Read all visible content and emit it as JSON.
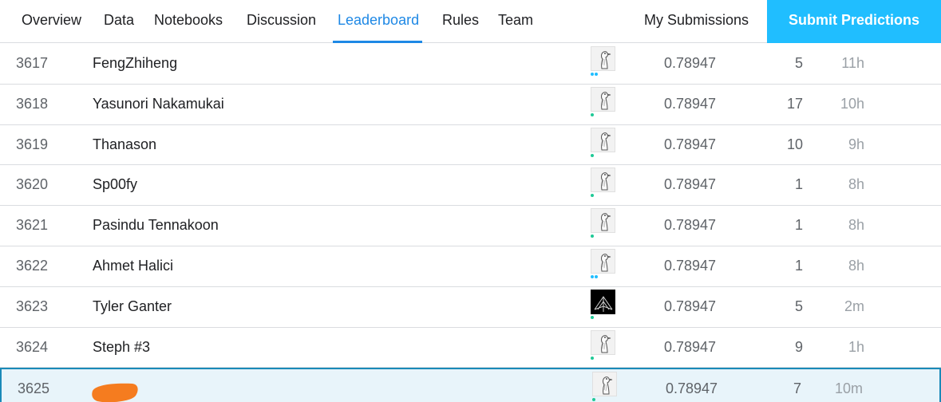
{
  "nav": {
    "tabs": [
      "Overview",
      "Data",
      "Notebooks",
      "Discussion",
      "Leaderboard",
      "Rules",
      "Team"
    ],
    "active_tab": "Leaderboard",
    "my_submissions": "My Submissions",
    "submit_label": "Submit Predictions"
  },
  "colors": {
    "accent": "#1e88e5",
    "submit_bg": "#20beff",
    "highlight_row_bg": "#e8f4fa",
    "highlight_row_border": "#1a8ab8",
    "dot_teal": "#20c997",
    "dot_blue": "#20beff",
    "redaction": "#f57c1f"
  },
  "leaderboard": {
    "rows": [
      {
        "rank": "3617",
        "team": "FengZhiheng",
        "avatar": "goose-icon",
        "dots": 2,
        "dot_color": "blue",
        "score": "0.78947",
        "entries": "5",
        "last": "11h"
      },
      {
        "rank": "3618",
        "team": "Yasunori Nakamukai",
        "avatar": "goose-icon",
        "dots": 1,
        "dot_color": "teal",
        "score": "0.78947",
        "entries": "17",
        "last": "10h"
      },
      {
        "rank": "3619",
        "team": "Thanason",
        "avatar": "goose-icon",
        "dots": 1,
        "dot_color": "teal",
        "score": "0.78947",
        "entries": "10",
        "last": "9h"
      },
      {
        "rank": "3620",
        "team": "Sp00fy",
        "avatar": "goose-icon",
        "dots": 1,
        "dot_color": "teal",
        "score": "0.78947",
        "entries": "1",
        "last": "8h"
      },
      {
        "rank": "3621",
        "team": "Pasindu Tennakoon",
        "avatar": "goose-icon",
        "dots": 1,
        "dot_color": "teal",
        "score": "0.78947",
        "entries": "1",
        "last": "8h"
      },
      {
        "rank": "3622",
        "team": "Ahmet Halici",
        "avatar": "goose-icon",
        "dots": 2,
        "dot_color": "blue",
        "score": "0.78947",
        "entries": "1",
        "last": "8h"
      },
      {
        "rank": "3623",
        "team": "Tyler Ganter",
        "avatar": "geometric-avatar-icon",
        "dots": 1,
        "dot_color": "teal",
        "score": "0.78947",
        "entries": "5",
        "last": "2m"
      },
      {
        "rank": "3624",
        "team": "Steph #3",
        "avatar": "goose-icon",
        "dots": 1,
        "dot_color": "teal",
        "score": "0.78947",
        "entries": "9",
        "last": "1h"
      },
      {
        "rank": "3625",
        "team": "",
        "redacted": true,
        "highlighted": true,
        "avatar": "goose-icon",
        "dots": 1,
        "dot_color": "teal",
        "score": "0.78947",
        "entries": "7",
        "last": "10m"
      }
    ]
  }
}
